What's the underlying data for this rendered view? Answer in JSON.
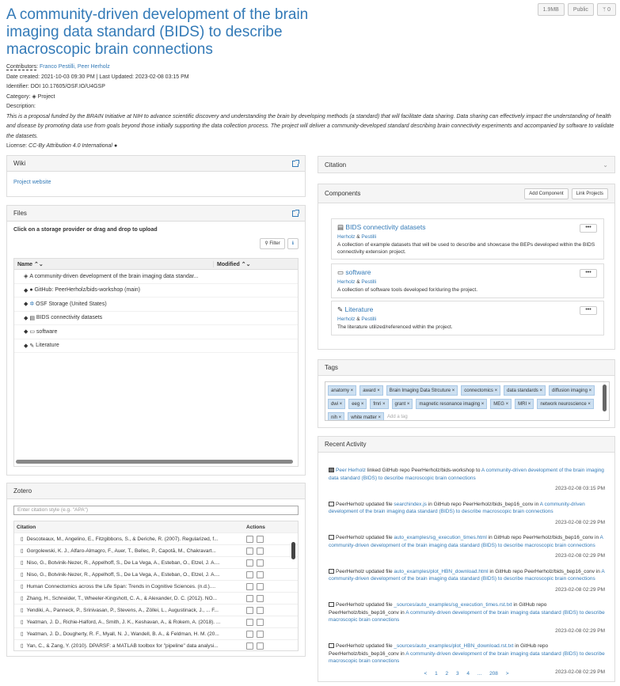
{
  "project": {
    "title": "A community-driven development of the brain imaging data standard (BIDS) to describe macroscopic brain connections",
    "size": "1.9MB",
    "visibility": "Public",
    "forks": "0",
    "contributors_label": "Contributors",
    "contributors": "Franco Pestilli, Peer Herholz",
    "date_line": "Date created: 2021-10-03 09:30 PM | Last Updated: 2023-02-08 03:15 PM",
    "identifier": "Identifier: DOI 10.17605/OSF.IO/U4GSP",
    "category_label": "Category:",
    "category": "Project",
    "description_label": "Description:",
    "description": "This is a proposal funded by the BRAIN Initiative at NIH to advance scientific discovery and understanding the brain by developing methods (a standard) that will facilitate data sharing. Data sharing can effectively impact the understanding of health and disease by promoting data use from goals beyond those initially supporting the data collection process. The project will deliver a community-developed standard describing brain connectivity experiments and accompanied by software to validate the datasets.",
    "license_label": "License:",
    "license": "CC-By Attribution 4.0 International"
  },
  "wiki": {
    "heading": "Wiki",
    "link": "Project website"
  },
  "files": {
    "heading": "Files",
    "instruction": "Click on a storage provider or drag and drop to upload",
    "filter": "Filter",
    "col_name": "Name",
    "col_modified": "Modified",
    "rows": [
      "A community-driven development of the brain imaging data standar...",
      "GitHub: PeerHerholz/bids-workshop (main)",
      "OSF Storage (United States)",
      "BIDS connectivity datasets",
      "software",
      "Literature"
    ]
  },
  "zotero": {
    "heading": "Zotero",
    "placeholder": "Enter citation style (e.g. \"APA\")",
    "col_citation": "Citation",
    "col_actions": "Actions",
    "rows": [
      "Descoteaux, M., Angelino, E., Fitzgibbons, S., & Deriche, R. (2007). Regularized, f...",
      "Gorgolewski, K. J., Alfaro-Almagro, F., Auer, T., Bellec, P., Capotă, M., Chakravart...",
      "Niso, G., Botvinik-Nezer, R., Appelhoff, S., De La Vega, A., Esteban, O., Etzel, J. A....",
      "Niso, G., Botvinik-Nezer, R., Appelhoff, S., De La Vega, A., Esteban, O., Etzel, J. A....",
      "Human Connectomics across the Life Span: Trends in Cognitive Sciences. (n.d.)....",
      "Zhang, H., Schneider, T., Wheeler-Kingshott, C. A., & Alexander, D. C. (2012). NO...",
      "Yendiki, A., Panneck, P., Srinivasan, P., Stevens, A., Zöllei, L., Augustinack, J., ... F...",
      "Yeatman, J. D., Richie-Halford, A., Smith, J. K., Keshavan, A., & Rokem, A. (2018). ...",
      "Yeatman, J. D., Dougherty, R. F., Myall, N. J., Wandell, B. A., & Feldman, H. M. (20...",
      "Yan, C., & Zang, Y. (2010). DPARSF: a MATLAB toolbox for \"pipeline\" data analysi..."
    ]
  },
  "citation": {
    "heading": "Citation"
  },
  "components": {
    "heading": "Components",
    "add": "Add Component",
    "link": "Link Projects",
    "more": "•••",
    "items": [
      {
        "title": "BIDS connectivity datasets",
        "a1": "Herholz",
        "amp": "&",
        "a2": "Pestilli",
        "desc": "A collection of example datasets that will be used to describe and showcase the BEPs developed within the BIDS connectivity extension project."
      },
      {
        "title": "software",
        "a1": "Herholz",
        "amp": "&",
        "a2": "Pestilli",
        "desc": "A collection of software tools developed for/during the project."
      },
      {
        "title": "Literature",
        "a1": "Herholz",
        "amp": "&",
        "a2": "Pestilli",
        "desc": "The literature utilized/referenced within the project."
      }
    ]
  },
  "tags": {
    "heading": "Tags",
    "add_placeholder": "Add a tag",
    "items": [
      "anatomy",
      "award",
      "Brain Imaging Data Strcuture",
      "connectomics",
      "data standards",
      "diffusion imaging",
      "dwi",
      "eeg",
      "fmri",
      "grant",
      "magnetic resonance imaging",
      "MEG",
      "MRI",
      "network neuroscience",
      "nih",
      "white matter"
    ]
  },
  "activity": {
    "heading": "Recent Activity",
    "items": [
      {
        "user": "Peer Herholz",
        "text": " linked GitHub repo PeerHerholz/bids-workshop to ",
        "target": "A community-driven development of the brain imaging data standard (BIDS) to describe macroscopic brain connections",
        "date": "2023-02-08 03:15 PM"
      },
      {
        "user": "PeerHerholz",
        "pre": " updated file ",
        "file": "searchindex.js",
        "mid": " in GitHub repo PeerHerholz/bids_bep16_conv in ",
        "target": "A community-driven development of the brain imaging data standard (BIDS) to describe macroscopic brain connections",
        "date": "2023-02-08 02:29 PM"
      },
      {
        "user": "PeerHerholz",
        "pre": " updated file ",
        "file": "auto_examples/sg_execution_times.html",
        "mid": " in GitHub repo PeerHerholz/bids_bep16_conv in ",
        "target": "A community-driven development of the brain imaging data standard (BIDS) to describe macroscopic brain connections",
        "date": "2023-02-08 02:29 PM"
      },
      {
        "user": "PeerHerholz",
        "pre": " updated file ",
        "file": "auto_examples/plot_HBN_download.html",
        "mid": " in GitHub repo PeerHerholz/bids_bep16_conv in ",
        "target": "A community-driven development of the brain imaging data standard (BIDS) to describe macroscopic brain connections",
        "date": "2023-02-08 02:29 PM"
      },
      {
        "user": "PeerHerholz",
        "pre": " updated file ",
        "file": "_sources/auto_examples/sg_execution_times.rst.txt",
        "mid": " in GitHub repo PeerHerholz/bids_bep16_conv in ",
        "target": "A community-driven development of the brain imaging data standard (BIDS) to describe macroscopic brain connections",
        "date": "2023-02-08 02:29 PM"
      },
      {
        "user": "PeerHerholz",
        "pre": " updated file ",
        "file": "_sources/auto_examples/plot_HBN_download.rst.txt",
        "mid": " in GitHub repo PeerHerholz/bids_bep16_conv in ",
        "target": "A community-driven development of the brain imaging data standard (BIDS) to describe macroscopic brain connections",
        "date": "2023-02-08 02:29 PM"
      }
    ],
    "pager": [
      "<",
      "1",
      "2",
      "3",
      "4",
      "...",
      "208",
      ">"
    ]
  }
}
